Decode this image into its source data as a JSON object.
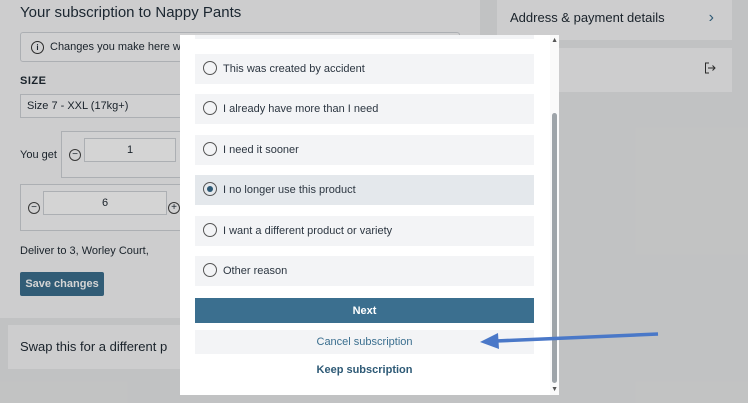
{
  "background": {
    "title": "Your subscription to Nappy Pants",
    "notice": "Changes you make here wi",
    "size_label": "SIZE",
    "size_value": "Size 7 - XXL (17kg+)",
    "you_get_label": "You get",
    "quantity_1": "1",
    "quantity_2": "6",
    "deliver_text": "Deliver to 3, Worley Court,",
    "save_button": "Save changes",
    "swap_text": "Swap this for a different p",
    "address_link": "Address & payment details"
  },
  "modal": {
    "options": [
      {
        "label": "This was created by accident",
        "selected": false
      },
      {
        "label": "I already have more than I need",
        "selected": false
      },
      {
        "label": "I need it sooner",
        "selected": false
      },
      {
        "label": "I no longer use this product",
        "selected": true
      },
      {
        "label": "I want a different product or variety",
        "selected": false
      },
      {
        "label": "Other reason",
        "selected": false
      }
    ],
    "next_button": "Next",
    "cancel_button": "Cancel subscription",
    "keep_button": "Keep subscription"
  },
  "colors": {
    "accent": "#3b6f8f",
    "annotation_arrow": "#4a78c8"
  }
}
